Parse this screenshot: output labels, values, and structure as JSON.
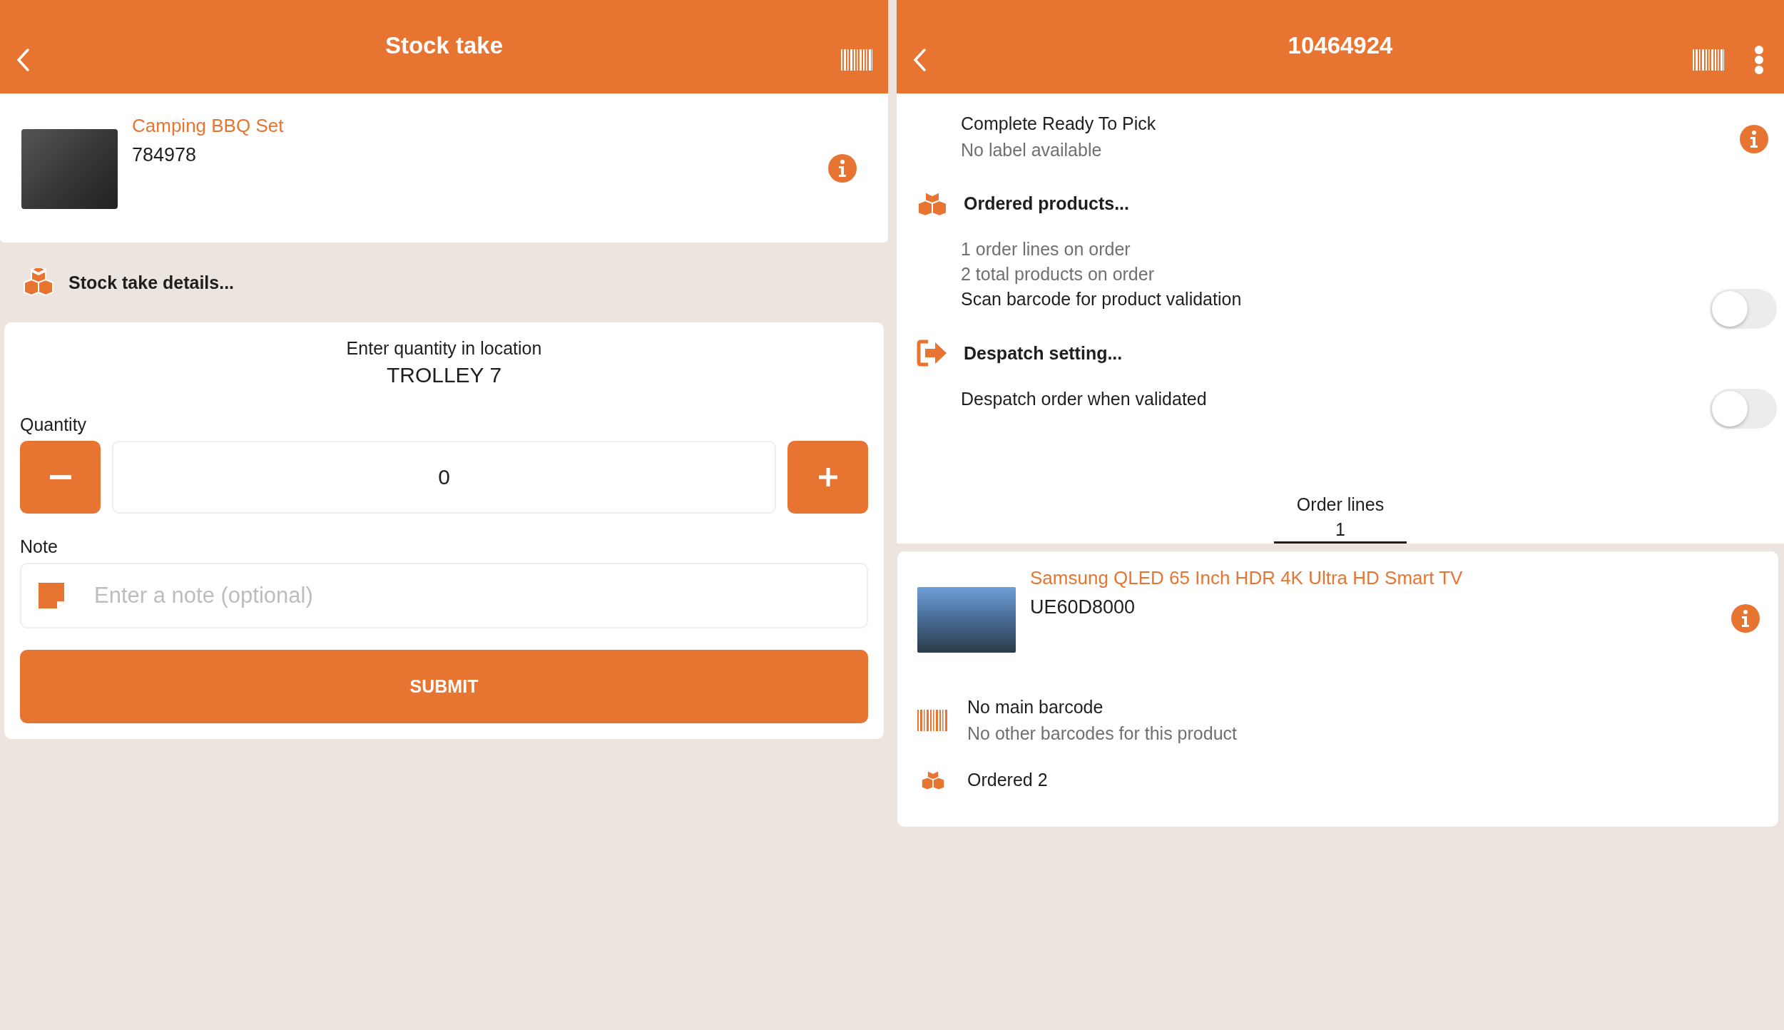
{
  "left": {
    "header": {
      "title": "Stock take"
    },
    "product": {
      "name": "Camping BBQ Set",
      "code": "784978"
    },
    "section": {
      "title": "Stock take details..."
    },
    "form": {
      "prompt": "Enter quantity in location",
      "location": "TROLLEY 7",
      "quantity_label": "Quantity",
      "quantity": "0",
      "note_label": "Note",
      "note": {
        "placeholder": "Enter a note (optional)"
      },
      "submit": "SUBMIT"
    }
  },
  "right": {
    "header": {
      "title": "10464924"
    },
    "status": {
      "title": "Complete Ready To Pick",
      "subtitle": "No label available"
    },
    "sections": [
      {
        "title": "Ordered products...",
        "lines": [
          {
            "kind": "muted",
            "text": "1 order lines on order"
          },
          {
            "kind": "muted",
            "text": "2 total products on order"
          },
          {
            "kind": "toggle",
            "text": "Scan barcode for product validation",
            "on": false
          }
        ]
      },
      {
        "title": "Despatch setting...",
        "lines": [
          {
            "kind": "toggle",
            "text": "Despatch order when validated",
            "on": false
          }
        ]
      }
    ],
    "tabs": [
      {
        "label": "Order lines",
        "count": "1",
        "selected": true
      }
    ],
    "order_lines": [
      {
        "name": "Samsung QLED 65 Inch HDR 4K Ultra HD Smart TV",
        "code": "UE60D8000",
        "details": [
          {
            "kind": "barcode",
            "title": "No main barcode",
            "subtitle": "No other barcodes for this product"
          },
          {
            "kind": "boxes",
            "title": "Ordered 2"
          }
        ]
      }
    ]
  }
}
